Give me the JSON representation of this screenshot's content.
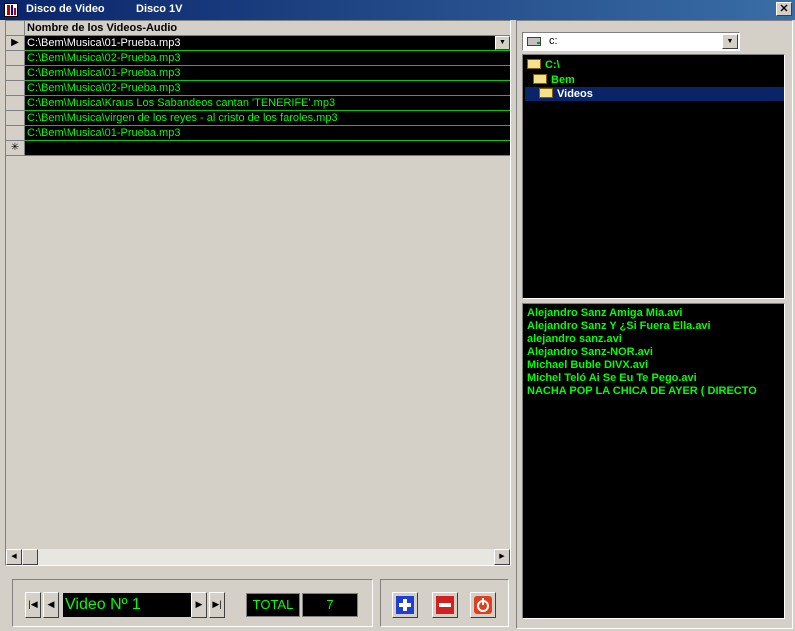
{
  "window": {
    "title": "Disco de Video",
    "subtitle": "Disco 1V",
    "close_label": "✕"
  },
  "grid": {
    "column_header": "Nombre de los Videos-Audio",
    "rows": [
      "C:\\Bem\\Musica\\01-Prueba.mp3",
      "C:\\Bem\\Musica\\02-Prueba.mp3",
      "C:\\Bem\\Musica\\01-Prueba.mp3",
      "C:\\Bem\\Musica\\02-Prueba.mp3",
      "C:\\Bem\\Musica\\Kraus  Los Sabandeos cantan 'TENERIFE'.mp3",
      "C:\\Bem\\Musica\\virgen de los reyes - al cristo de los faroles.mp3",
      "C:\\Bem\\Musica\\01-Prueba.mp3"
    ],
    "selected_indicator": "▶",
    "new_row_indicator": "✳"
  },
  "navigator": {
    "display": "Video Nº 1",
    "total_label": "TOTAL",
    "total_value": "7"
  },
  "drive": {
    "selected": "c:"
  },
  "tree": [
    "C:\\",
    "Bem",
    "Videos"
  ],
  "files": [
    "Alejandro Sanz  Amiga Mia.avi",
    "Alejandro Sanz  Y ¿Si Fuera Ella.avi",
    "alejandro sanz.avi",
    "Alejandro Sanz-NOR.avi",
    "Michael Buble DIVX.avi",
    "Michel Teló  Ai Se Eu Te Pego.avi",
    "NACHA POP  LA CHICA DE AYER ( DIRECTO"
  ],
  "colors": {
    "text_green": "#00ff00",
    "title_blue": "#0a246a",
    "add_blue": "#1f3fd0",
    "remove_red": "#d02020",
    "power_red": "#e04020"
  }
}
